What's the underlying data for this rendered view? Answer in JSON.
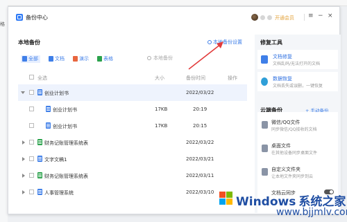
{
  "background": {
    "left_text": "格"
  },
  "window": {
    "title": "备份中心",
    "vip_label": "开通会员",
    "controls": {
      "menu": "≡",
      "minimize": "−",
      "close": "×"
    }
  },
  "local_backup": {
    "title": "本地备份",
    "settings_label": "本地备份设置",
    "filters": [
      {
        "label": "全部",
        "color": "#3f7fe8"
      },
      {
        "label": "文档",
        "color": "#3f7fe8"
      },
      {
        "label": "演示",
        "color": "#e8663f"
      },
      {
        "label": "表格",
        "color": "#2ba24c"
      }
    ],
    "search_placeholder": "本地备份",
    "columns": {
      "select_all": "全选",
      "size": "大小",
      "time": "备份时间",
      "actions": "操作"
    },
    "rows": [
      {
        "name": "创业计划书",
        "size": "",
        "time": "2022/03/22",
        "expanded": true,
        "child": false,
        "selected": true
      },
      {
        "name": "创业计划书",
        "size": "17KB",
        "time": "20:19",
        "expanded": false,
        "child": true,
        "selected": false
      },
      {
        "name": "创业计划书",
        "size": "17KB",
        "time": "20:15",
        "expanded": false,
        "child": true,
        "selected": false
      },
      {
        "name": "财务记账管理系统表",
        "size": "",
        "time": "2022/03/22",
        "expanded": false,
        "child": false,
        "selected": false
      },
      {
        "name": "文字文稿1",
        "size": "",
        "time": "2022/03/21",
        "expanded": false,
        "child": false,
        "selected": false
      },
      {
        "name": "财务记账管理系统表",
        "size": "",
        "time": "2022/03/11",
        "expanded": false,
        "child": false,
        "selected": false
      },
      {
        "name": "人事管理系统",
        "size": "",
        "time": "2022/03/10",
        "expanded": false,
        "child": false,
        "selected": false
      }
    ]
  },
  "repair_tools": {
    "title": "修复工具",
    "items": [
      {
        "title": "文档修复",
        "desc": "文档乱码/无法打开的文档",
        "color": "#3f7fe8"
      },
      {
        "title": "数据恢复",
        "desc": "文档丢失或误删，一键恢复",
        "color": "#2f9fd8"
      }
    ]
  },
  "cloud_backup": {
    "title": "云端备份",
    "manual_label": "手动备份",
    "items": [
      {
        "title": "微信/QQ文件",
        "desc": "同步微信/QQ接收的文档"
      },
      {
        "title": "桌面文件",
        "desc": "在其他设备同步桌面文件"
      },
      {
        "title": "自定义文件夹",
        "desc": "让本地文件夹同步到云"
      },
      {
        "title": "文档云同步",
        "desc": ""
      }
    ]
  },
  "watermark": {
    "brand": "Windows",
    "cn": "系统之家",
    "url": "www.bjjmlv.com"
  }
}
